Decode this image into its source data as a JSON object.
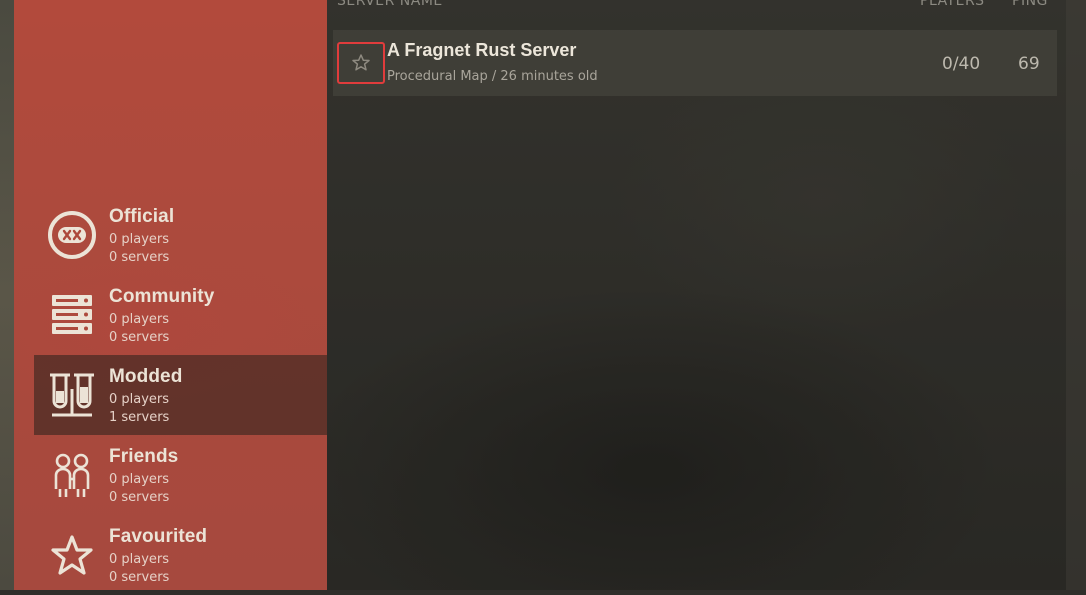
{
  "columns": {
    "server_name": "SERVER NAME",
    "players": "PLAYERS",
    "ping": "PING"
  },
  "categories": [
    {
      "title": "Official",
      "players": "0 players",
      "servers": "0 servers",
      "icon": "official-badge-icon",
      "selected": false
    },
    {
      "title": "Community",
      "players": "0 players",
      "servers": "0 servers",
      "icon": "server-rack-icon",
      "selected": false
    },
    {
      "title": "Modded",
      "players": "0 players",
      "servers": "1 servers",
      "icon": "test-tubes-icon",
      "selected": true
    },
    {
      "title": "Friends",
      "players": "0 players",
      "servers": "0 servers",
      "icon": "friends-icon",
      "selected": false
    },
    {
      "title": "Favourited",
      "players": "0 players",
      "servers": "0 servers",
      "icon": "star-icon",
      "selected": false
    }
  ],
  "servers": [
    {
      "name": "A Fragnet Rust Server",
      "description": "Procedural Map / 26 minutes old",
      "players": "0/40",
      "ping": "69",
      "favourite_icon": "star-outline-icon"
    }
  ],
  "colors": {
    "sidebar": "#ad4a3d",
    "selected_category": "#3a2e29",
    "highlight_border": "#e03c3c"
  }
}
